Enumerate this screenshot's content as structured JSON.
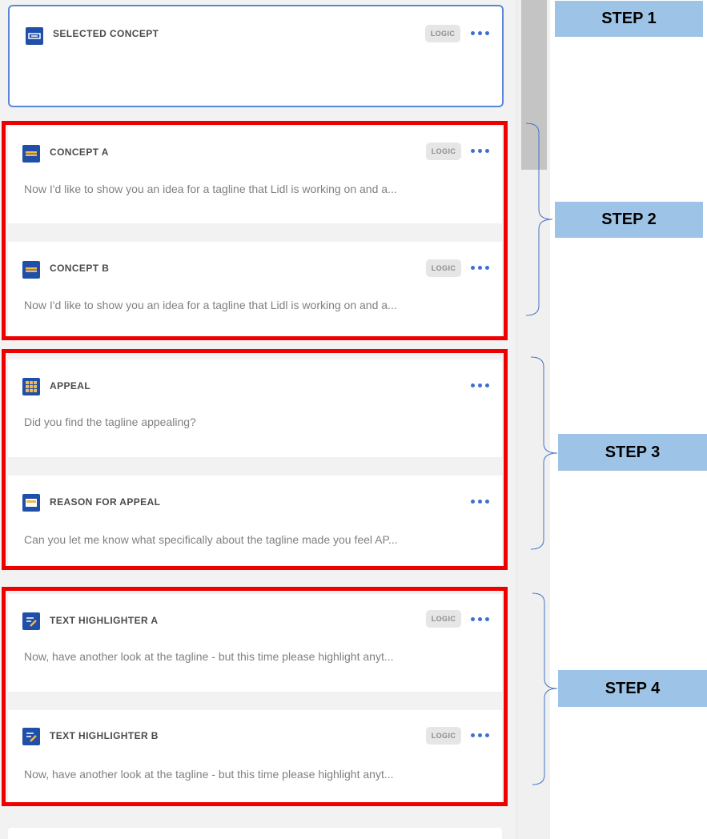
{
  "questions": [
    {
      "title": "SELECTED CONCEPT",
      "text": "",
      "logic": "LOGIC",
      "icon": "concept-icon"
    },
    {
      "title": "CONCEPT A",
      "text": "Now I'd like to show you an idea for a tagline that Lidl is working on and a...",
      "logic": "LOGIC",
      "icon": "concept-icon"
    },
    {
      "title": "CONCEPT B",
      "text": "Now I'd like to show you an idea for a tagline that Lidl is working on and a...",
      "logic": "LOGIC",
      "icon": "concept-icon"
    },
    {
      "title": "APPEAL",
      "text": "Did you find the tagline appealing?",
      "logic": "",
      "icon": "grid-question-icon"
    },
    {
      "title": "REASON FOR APPEAL",
      "text": "Can you let me know what specifically about the tagline made you feel AP...",
      "logic": "",
      "icon": "open-text-icon"
    },
    {
      "title": "TEXT HIGHLIGHTER A",
      "text": "Now, have another look at the tagline - but this time please highlight anyt...",
      "logic": "LOGIC",
      "icon": "highlighter-icon"
    },
    {
      "title": "TEXT HIGHLIGHTER B",
      "text": "Now, have another look at the tagline - but this time please highlight anyt...",
      "logic": "LOGIC",
      "icon": "highlighter-icon"
    }
  ],
  "steps": [
    "STEP 1",
    "STEP 2",
    "STEP 3",
    "STEP 4"
  ],
  "colors": {
    "icon": "#1f4fa8",
    "dots": "#3d6fd1",
    "annotation_frame": "#ee0000",
    "step_label": "#9dc3e6",
    "selected_border": "#5b86d6"
  }
}
